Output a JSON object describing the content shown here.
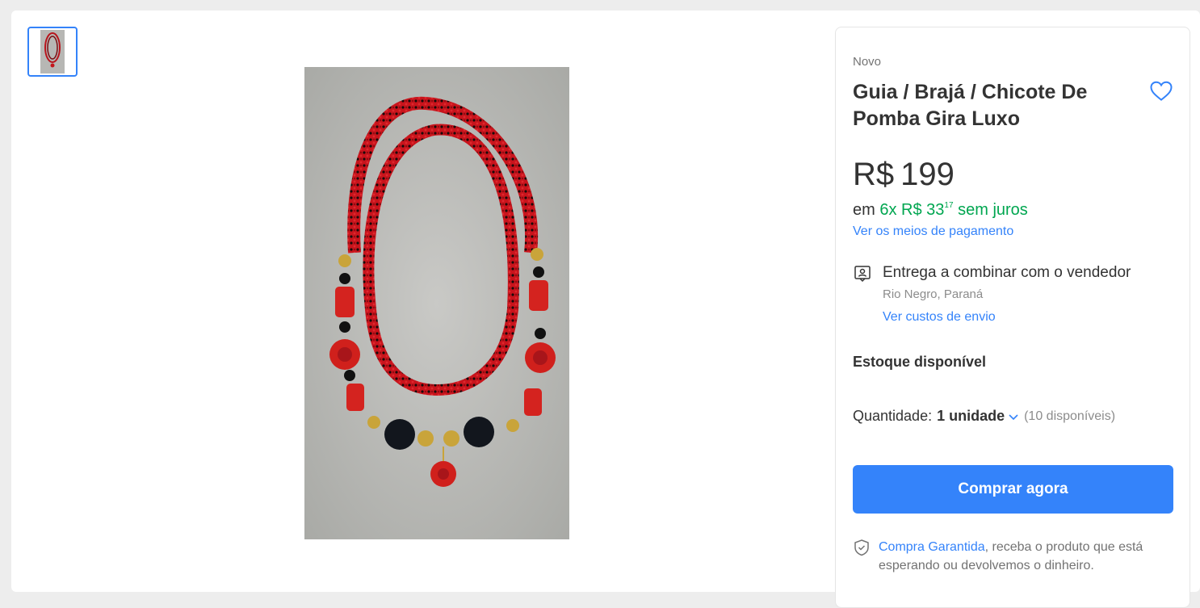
{
  "product": {
    "condition": "Novo",
    "title": "Guia / Brajá / Chicote De Pomba Gira Luxo",
    "price_currency": "R$",
    "price_value": "199",
    "installments_prefix": "em",
    "installments_main": "6x R$ 33",
    "installments_cents": "17",
    "installments_suffix": "sem juros",
    "payment_link": "Ver os meios de pagamento"
  },
  "delivery": {
    "title": "Entrega a combinar com o vendedor",
    "location": "Rio Negro, Paraná",
    "shipping_link": "Ver custos de envio"
  },
  "stock": {
    "label": "Estoque disponível"
  },
  "quantity": {
    "label": "Quantidade:",
    "value": "1 unidade",
    "available": "(10 disponíveis)"
  },
  "actions": {
    "buy_now": "Comprar agora"
  },
  "guarantee": {
    "link": "Compra Garantida",
    "text": ", receba o produto que está esperando ou devolvemos o dinheiro."
  },
  "colors": {
    "accent": "#3483fa",
    "green": "#00a650"
  },
  "icons": {
    "favorite": "heart-icon",
    "delivery": "person-card-icon",
    "quantity_dropdown": "chevron-down-icon",
    "guarantee": "shield-check-icon"
  }
}
